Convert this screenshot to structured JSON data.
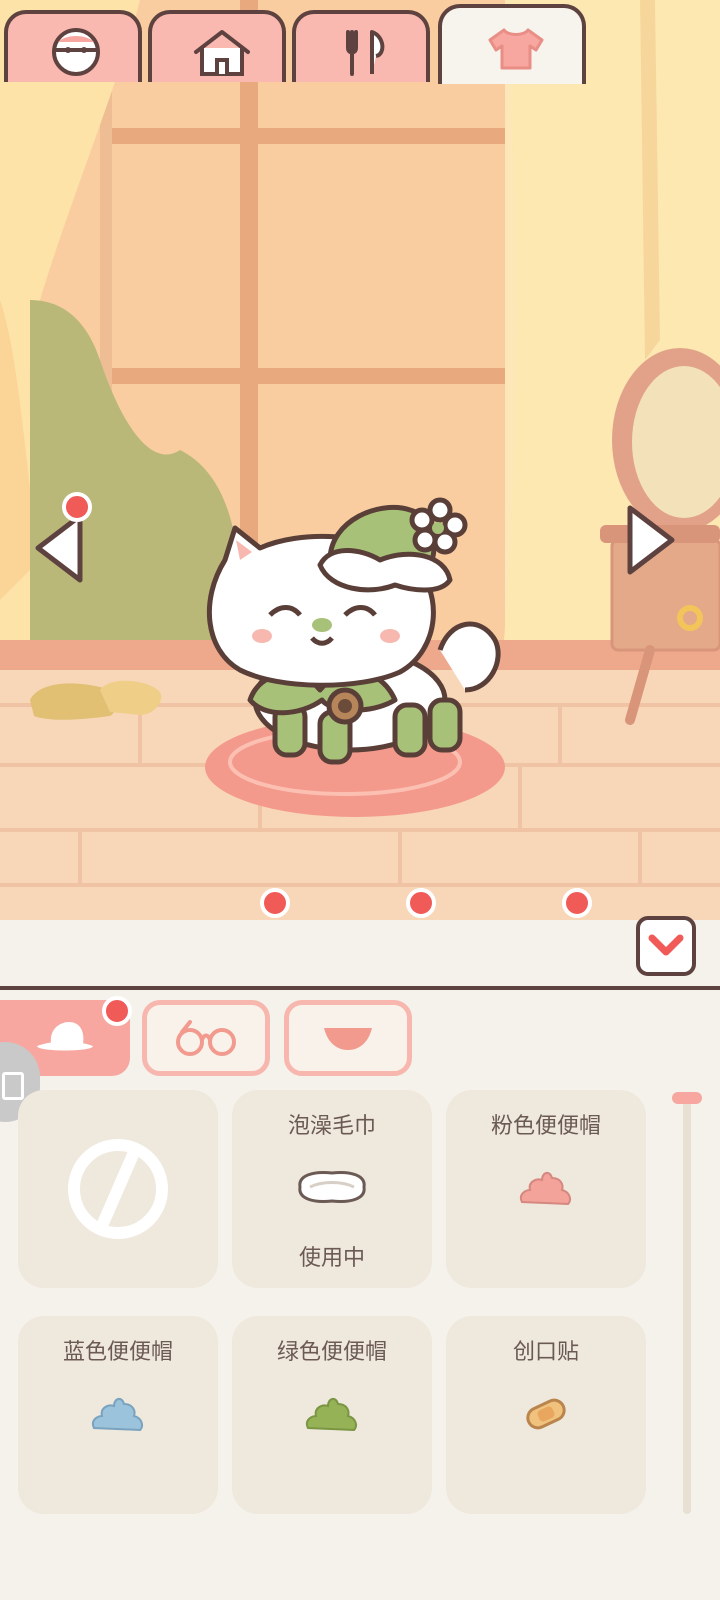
{
  "scene": {
    "left_arrow_icon": "triangle-left-icon",
    "right_arrow_icon": "triangle-right-icon",
    "character": "white-kitten-with-green-hat"
  },
  "tabs": [
    {
      "name": "character",
      "icon": "face-icon",
      "active": false,
      "badge": false
    },
    {
      "name": "home",
      "icon": "house-icon",
      "active": false,
      "badge": true
    },
    {
      "name": "food",
      "icon": "fork-knife-icon",
      "active": false,
      "badge": true
    },
    {
      "name": "clothing",
      "icon": "shirt-icon",
      "active": true,
      "badge": true
    }
  ],
  "subtabs": [
    {
      "name": "hat",
      "icon": "hat-icon",
      "active": true,
      "badge": true
    },
    {
      "name": "glasses",
      "icon": "glasses-icon",
      "active": false
    },
    {
      "name": "neck",
      "icon": "bib-icon",
      "active": false
    }
  ],
  "items": [
    {
      "name": "",
      "icon": "none-icon",
      "status": ""
    },
    {
      "name": "泡澡毛巾",
      "icon": "towel-icon",
      "status": "使用中"
    },
    {
      "name": "粉色便便帽",
      "icon": "pink-poop-hat-icon",
      "status": ""
    },
    {
      "name": "蓝色便便帽",
      "icon": "blue-poop-hat-icon",
      "status": ""
    },
    {
      "name": "绿色便便帽",
      "icon": "green-poop-hat-icon",
      "status": ""
    },
    {
      "name": "创口贴",
      "icon": "bandage-icon",
      "status": ""
    }
  ],
  "colors": {
    "accent_pink": "#f7a79f",
    "badge_red": "#f05a57",
    "outline_brown": "#5e4240",
    "card_bg": "#efe8dd",
    "panel_bg": "#f5f2ec"
  }
}
